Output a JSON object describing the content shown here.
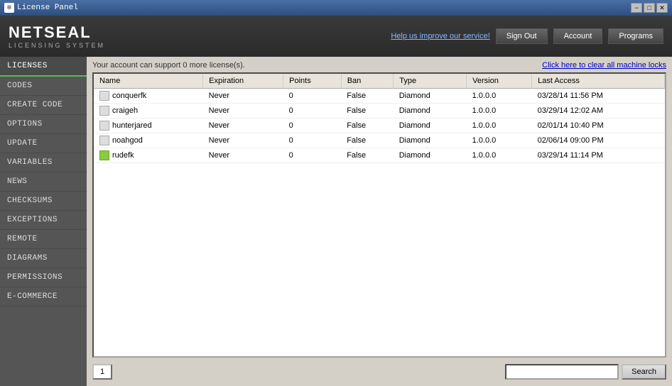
{
  "titlebar": {
    "title": "License Panel",
    "minimize": "−",
    "maximize": "□",
    "close": "✕"
  },
  "header": {
    "brand_name": "NETSEAL",
    "brand_sub": "LICENSING SYSTEM",
    "help_link": "Help us improve our service!",
    "sign_out": "Sign Out",
    "account": "Account",
    "programs": "Programs"
  },
  "sidebar": {
    "items": [
      {
        "label": "LICENSES",
        "active": true
      },
      {
        "label": "CODES",
        "active": false
      },
      {
        "label": "CREATE CODE",
        "active": false
      },
      {
        "label": "OPTIONS",
        "active": false
      },
      {
        "label": "UPDATE",
        "active": false
      },
      {
        "label": "VARIABLES",
        "active": false
      },
      {
        "label": "NEWS",
        "active": false
      },
      {
        "label": "CHECKSUMS",
        "active": false
      },
      {
        "label": "EXCEPTIONS",
        "active": false
      },
      {
        "label": "REMOTE",
        "active": false
      },
      {
        "label": "DIAGRAMS",
        "active": false
      },
      {
        "label": "PERMISSIONS",
        "active": false
      },
      {
        "label": "E-COMMERCE",
        "active": false
      }
    ]
  },
  "content": {
    "account_msg": "Your account can support 0 more license(s).",
    "clear_locks": "Click here to clear all machine locks",
    "table": {
      "headers": [
        "Name",
        "Expiration",
        "Points",
        "Ban",
        "Type",
        "Version",
        "Last Access"
      ],
      "rows": [
        {
          "icon": "gray",
          "name": "conquerfk",
          "expiration": "Never",
          "points": "0",
          "ban": "False",
          "type": "Diamond",
          "version": "1.0.0.0",
          "last_access": "03/28/14 11:56 PM"
        },
        {
          "icon": "gray",
          "name": "craigeh",
          "expiration": "Never",
          "points": "0",
          "ban": "False",
          "type": "Diamond",
          "version": "1.0.0.0",
          "last_access": "03/29/14 12:02 AM"
        },
        {
          "icon": "gray",
          "name": "hunterjared",
          "expiration": "Never",
          "points": "0",
          "ban": "False",
          "type": "Diamond",
          "version": "1.0.0.0",
          "last_access": "02/01/14 10:40 PM"
        },
        {
          "icon": "gray",
          "name": "noahgod",
          "expiration": "Never",
          "points": "0",
          "ban": "False",
          "type": "Diamond",
          "version": "1.0.0.0",
          "last_access": "02/06/14 09:00 PM"
        },
        {
          "icon": "green",
          "name": "rudefk",
          "expiration": "Never",
          "points": "0",
          "ban": "False",
          "type": "Diamond",
          "version": "1.0.0.0",
          "last_access": "03/29/14 11:14 PM"
        }
      ]
    },
    "page_btn": "1",
    "search_placeholder": "",
    "search_btn": "Search"
  }
}
